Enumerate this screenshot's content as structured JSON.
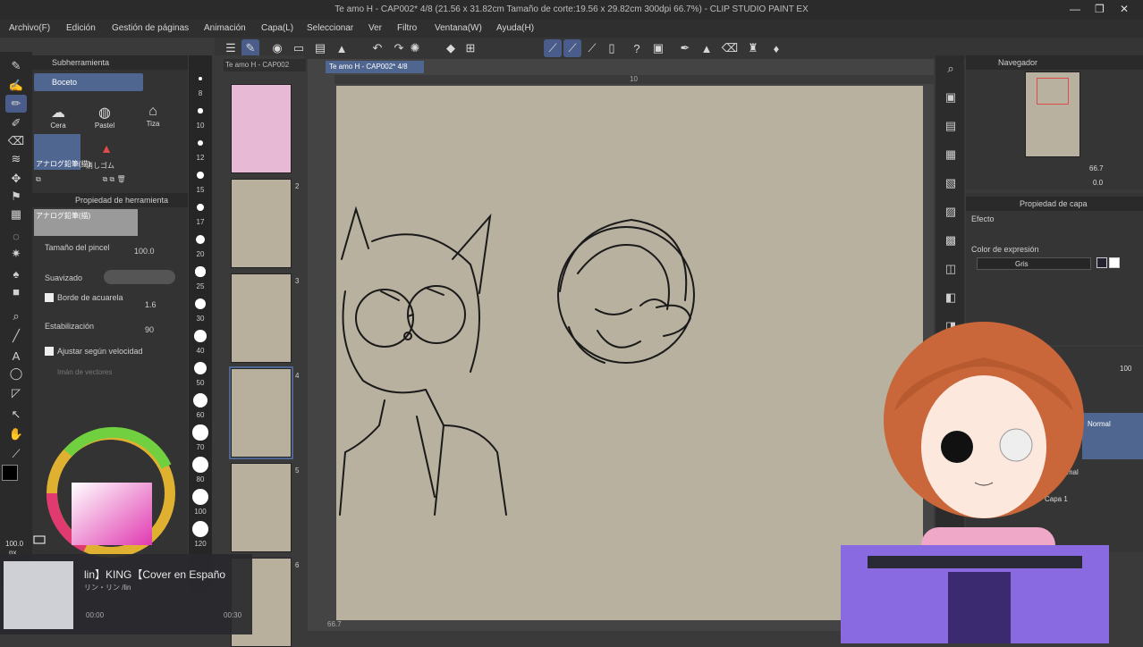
{
  "window": {
    "title": "Te amo H - CAP002* 4/8 (21.56 x 31.82cm Tamaño de corte:19.56 x 29.82cm 300dpi 66.7%) - CLIP STUDIO PAINT EX",
    "min": "—",
    "max": "❐",
    "close": "✕"
  },
  "menu": [
    "Archivo(F)",
    "Edición",
    "Gestión de páginas",
    "Animación",
    "Capa(L)",
    "Seleccionar",
    "Ver",
    "Filtro",
    "Ventana(W)",
    "Ayuda(H)"
  ],
  "subtool": {
    "header": "Subherramienta",
    "group": "Boceto",
    "brushes": [
      "Cera",
      "Pastel",
      "Tiza"
    ],
    "selected_brush": "アナログ鉛筆(描)",
    "selected_brush2": "消しゴム"
  },
  "props": {
    "header": "Propiedad de herramienta",
    "brush_name": "アナログ鉛筆(描)",
    "size_label": "Tamaño del pincel",
    "size_value": "100.0",
    "smooth_label": "Suavizado",
    "border_label": "Borde de acuarela",
    "border_value": "1.6",
    "stab_label": "Estabilización",
    "stab_value": "90",
    "speed_label": "Ajustar según velocidad",
    "vector_label": "Imán de vectores"
  },
  "color": {
    "main": "#000000",
    "sub": "#ffffff",
    "accent": "#e03ab0",
    "opacity": "100.0",
    "unit": "px"
  },
  "sizes": [
    "8",
    "10",
    "12",
    "15",
    "17",
    "20",
    "25",
    "30",
    "40",
    "50",
    "60",
    "70",
    "80",
    "100",
    "120"
  ],
  "pages": {
    "tab": "Te amo H - CAP002",
    "numbers": [
      "2",
      "3",
      "4",
      "5",
      "6"
    ]
  },
  "canvas": {
    "tab": "Te amo H - CAP002* 4/8",
    "ruler_mark": "10",
    "zoom": "66.7",
    "bg": "#b9b19f"
  },
  "navigator": {
    "header": "Navegador",
    "zoom": "66.7",
    "angle": "0.0"
  },
  "properties": {
    "header": "Propiedad de capa",
    "effect_label": "Efecto",
    "color_label": "Color de expresión",
    "color_value": "Gris"
  },
  "layers": {
    "opacity": "100",
    "items": [
      "Normal",
      "Normal",
      "Capa 1"
    ]
  },
  "music": {
    "title": "lin】KING【Cover en Españo",
    "subtitle": "リン・リン /lin",
    "time_current": "00:00",
    "time_total": "00:30"
  }
}
